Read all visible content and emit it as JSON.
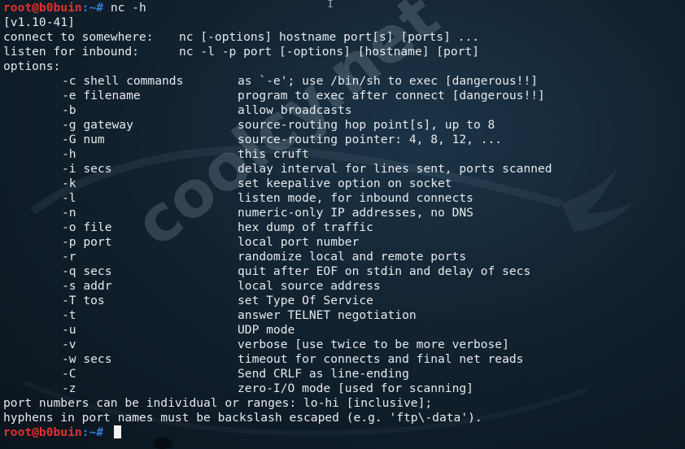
{
  "terminal": {
    "prompt_user": "root@b0buin",
    "prompt_sep": ":~# ",
    "command": "nc -h",
    "version": "[v1.10-41]",
    "usage": [
      {
        "label": "connect to somewhere:",
        "syntax": "nc [-options] hostname port[s] [ports] ..."
      },
      {
        "label": "listen for inbound:",
        "syntax": "nc -l -p port [-options] [hostname] [port]"
      }
    ],
    "options_header": "options:",
    "options": [
      {
        "flag": "-c shell commands",
        "desc": "as `-e'; use /bin/sh to exec [dangerous!!]"
      },
      {
        "flag": "-e filename",
        "desc": "program to exec after connect [dangerous!!]"
      },
      {
        "flag": "-b",
        "desc": "allow broadcasts"
      },
      {
        "flag": "-g gateway",
        "desc": "source-routing hop point[s], up to 8"
      },
      {
        "flag": "-G num",
        "desc": "source-routing pointer: 4, 8, 12, ..."
      },
      {
        "flag": "-h",
        "desc": "this cruft"
      },
      {
        "flag": "-i secs",
        "desc": "delay interval for lines sent, ports scanned"
      },
      {
        "flag": "-k",
        "desc": "set keepalive option on socket"
      },
      {
        "flag": "-l",
        "desc": "listen mode, for inbound connects"
      },
      {
        "flag": "-n",
        "desc": "numeric-only IP addresses, no DNS"
      },
      {
        "flag": "-o file",
        "desc": "hex dump of traffic"
      },
      {
        "flag": "-p port",
        "desc": "local port number"
      },
      {
        "flag": "-r",
        "desc": "randomize local and remote ports"
      },
      {
        "flag": "-q secs",
        "desc": "quit after EOF on stdin and delay of secs"
      },
      {
        "flag": "-s addr",
        "desc": "local source address"
      },
      {
        "flag": "-T tos",
        "desc": "set Type Of Service"
      },
      {
        "flag": "-t",
        "desc": "answer TELNET negotiation"
      },
      {
        "flag": "-u",
        "desc": "UDP mode"
      },
      {
        "flag": "-v",
        "desc": "verbose [use twice to be more verbose]"
      },
      {
        "flag": "-w secs",
        "desc": "timeout for connects and final net reads"
      },
      {
        "flag": "-C",
        "desc": "Send CRLF as line-ending"
      },
      {
        "flag": "-z",
        "desc": "zero-I/O mode [used for scanning]"
      }
    ],
    "footer": [
      "port numbers can be individual or ranges: lo-hi [inclusive];",
      "hyphens in port names must be backslash escaped (e.g. 'ftp\\-data')."
    ],
    "watermark": "coolcy.net"
  },
  "colors": {
    "prompt_user": "#e0312e",
    "prompt_path": "#3a7bd5",
    "text": "#e6e9ec",
    "background": "#12222f"
  }
}
